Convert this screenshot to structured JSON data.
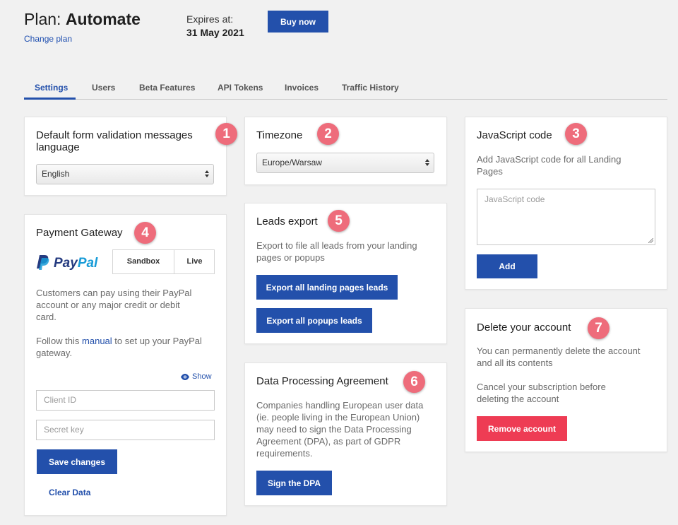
{
  "plan": {
    "label": "Plan:",
    "name": "Automate",
    "change_plan": "Change plan",
    "expires_label": "Expires at:",
    "expires_date": "31 May 2021",
    "buy_now": "Buy now"
  },
  "tabs": [
    "Settings",
    "Users",
    "Beta Features",
    "API Tokens",
    "Invoices",
    "Traffic History"
  ],
  "active_tab": "Settings",
  "badges": [
    "1",
    "2",
    "3",
    "4",
    "5",
    "6",
    "7"
  ],
  "validation": {
    "title_line1": "Default form validation messages",
    "title_line2": "language",
    "selected": "English"
  },
  "timezone": {
    "title": "Timezone",
    "selected": "Europe/Warsaw"
  },
  "javascript": {
    "title": "JavaScript code",
    "desc_line1": "Add JavaScript code for all Landing",
    "desc_line2": "Pages",
    "placeholder": "JavaScript code",
    "add": "Add"
  },
  "payment": {
    "title": "Payment Gateway",
    "logo_text_1": "Pay",
    "logo_text_2": "Pal",
    "sandbox": "Sandbox",
    "live": "Live",
    "desc_line1": "Customers can pay using their PayPal",
    "desc_line2": "account or any major credit or debit",
    "desc_line3": "card.",
    "follow_pre": "Follow this ",
    "manual": "manual",
    "follow_post": " to set up your PayPal",
    "follow_line2": "gateway.",
    "show": "Show",
    "client_id_placeholder": "Client ID",
    "secret_key_placeholder": "Secret key",
    "save": "Save changes",
    "clear": "Clear Data"
  },
  "leads": {
    "title": "Leads export",
    "desc_line1": "Export to file all leads from your landing",
    "desc_line2": "pages or popups",
    "export_landing": "Export all landing pages leads",
    "export_popups": "Export all popups leads"
  },
  "dpa": {
    "title": "Data Processing Agreement",
    "desc_lines": [
      "Companies handling European user data",
      "(ie. people living in the European Union)",
      "may need to sign the Data Processing",
      "Agreement (DPA), as part of GDPR",
      "requirements."
    ],
    "sign": "Sign the DPA"
  },
  "delete": {
    "title": "Delete your account",
    "desc_line1": "You can permanently delete the account",
    "desc_line2": "and all its contents",
    "cancel_line1": "Cancel your subscription before",
    "cancel_line2": "deleting the account",
    "remove": "Remove account"
  },
  "colors": {
    "accent": "#2350ab",
    "badge": "#ee6c7b",
    "danger": "#ee3c54",
    "paypal_dark": "#253b80",
    "paypal_light": "#179bd7"
  }
}
